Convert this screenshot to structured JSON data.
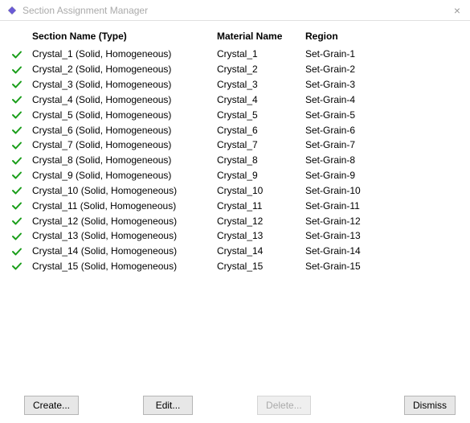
{
  "window": {
    "title": "Section Assignment Manager"
  },
  "table": {
    "headers": {
      "name": "Section Name (Type)",
      "material": "Material Name",
      "region": "Region"
    },
    "rows": [
      {
        "name": "Crystal_1 (Solid, Homogeneous)",
        "material": "Crystal_1",
        "region": "Set-Grain-1"
      },
      {
        "name": "Crystal_2 (Solid, Homogeneous)",
        "material": "Crystal_2",
        "region": "Set-Grain-2"
      },
      {
        "name": "Crystal_3 (Solid, Homogeneous)",
        "material": "Crystal_3",
        "region": "Set-Grain-3"
      },
      {
        "name": "Crystal_4 (Solid, Homogeneous)",
        "material": "Crystal_4",
        "region": "Set-Grain-4"
      },
      {
        "name": "Crystal_5 (Solid, Homogeneous)",
        "material": "Crystal_5",
        "region": "Set-Grain-5"
      },
      {
        "name": "Crystal_6 (Solid, Homogeneous)",
        "material": "Crystal_6",
        "region": "Set-Grain-6"
      },
      {
        "name": "Crystal_7 (Solid, Homogeneous)",
        "material": "Crystal_7",
        "region": "Set-Grain-7"
      },
      {
        "name": "Crystal_8 (Solid, Homogeneous)",
        "material": "Crystal_8",
        "region": "Set-Grain-8"
      },
      {
        "name": "Crystal_9 (Solid, Homogeneous)",
        "material": "Crystal_9",
        "region": "Set-Grain-9"
      },
      {
        "name": "Crystal_10 (Solid, Homogeneous)",
        "material": "Crystal_10",
        "region": "Set-Grain-10"
      },
      {
        "name": "Crystal_11 (Solid, Homogeneous)",
        "material": "Crystal_11",
        "region": "Set-Grain-11"
      },
      {
        "name": "Crystal_12 (Solid, Homogeneous)",
        "material": "Crystal_12",
        "region": "Set-Grain-12"
      },
      {
        "name": "Crystal_13 (Solid, Homogeneous)",
        "material": "Crystal_13",
        "region": "Set-Grain-13"
      },
      {
        "name": "Crystal_14 (Solid, Homogeneous)",
        "material": "Crystal_14",
        "region": "Set-Grain-14"
      },
      {
        "name": "Crystal_15 (Solid, Homogeneous)",
        "material": "Crystal_15",
        "region": "Set-Grain-15"
      }
    ]
  },
  "buttons": {
    "create": "Create...",
    "edit": "Edit...",
    "delete": "Delete...",
    "dismiss": "Dismiss"
  }
}
